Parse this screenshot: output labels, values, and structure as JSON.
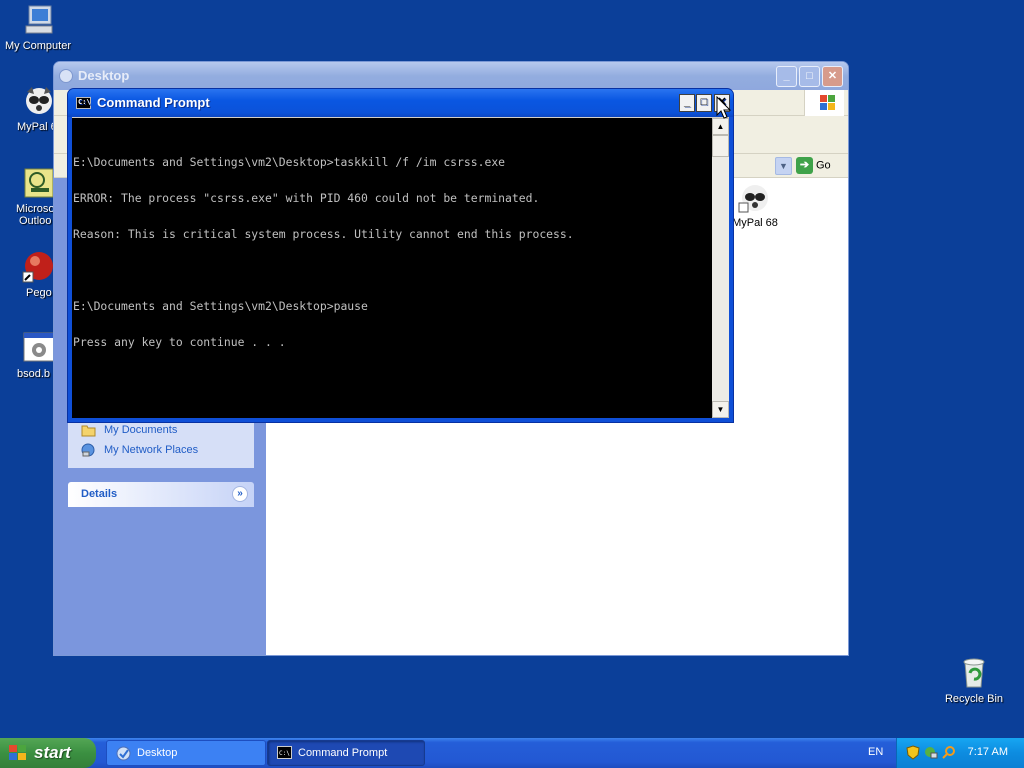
{
  "desktop": {
    "icons": [
      {
        "label": "My Computer"
      },
      {
        "label": "MyPal 6"
      },
      {
        "label": "Microso"
      },
      {
        "label": "Outloo"
      },
      {
        "label": "Pego"
      },
      {
        "label": "bsod.b"
      },
      {
        "label": "Recycle Bin"
      }
    ]
  },
  "explorer": {
    "title": "Desktop",
    "go_label": "Go",
    "places": [
      "My Documents",
      "My Network Places"
    ],
    "details_label": "Details",
    "file_label": "MyPal 68"
  },
  "cmd": {
    "title": "Command Prompt",
    "icon_text": "C:\\",
    "lines": [
      "E:\\Documents and Settings\\vm2\\Desktop>taskkill /f /im csrss.exe",
      "ERROR: The process \"csrss.exe\" with PID 460 could not be terminated.",
      "Reason: This is critical system process. Utility cannot end this process.",
      "",
      "E:\\Documents and Settings\\vm2\\Desktop>pause",
      "Press any key to continue . . ."
    ]
  },
  "taskbar": {
    "start_label": "start",
    "buttons": [
      {
        "label": "Desktop",
        "active": false
      },
      {
        "label": "Command Prompt",
        "active": true
      }
    ],
    "language": "EN",
    "clock": "7:17 AM"
  },
  "colors": {
    "desktop_bg": "#0b3f99",
    "cmd_title": "#0b52d9",
    "start_green": "#3b9041",
    "tray_blue": "#0d8ce0"
  }
}
